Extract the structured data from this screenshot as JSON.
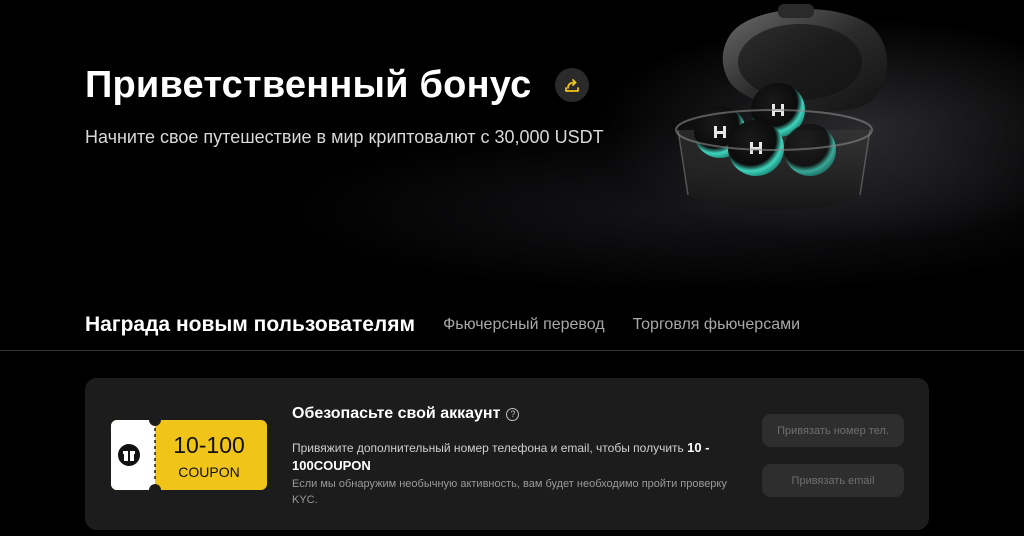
{
  "hero": {
    "title": "Приветственный бонус",
    "subtitle": "Начните свое путешествие в мир криптовалют с 30,000 USDT",
    "share_icon": "share-icon",
    "illustration": "crypto-coins-case-illustration"
  },
  "tabs": [
    {
      "label": "Награда новым пользователям",
      "active": true
    },
    {
      "label": "Фьючерсный перевод",
      "active": false
    },
    {
      "label": "Торговля фьючерсами",
      "active": false
    }
  ],
  "card": {
    "title": "Обезопасьте свой аккаунт",
    "help_icon": "help-icon",
    "coupon": {
      "amount": "10-100",
      "label": "COUPON",
      "icon": "gift-icon"
    },
    "desc_prefix": "Привяжите дополнительный номер телефона и email, чтобы получить ",
    "desc_highlight": "10 - 100COUPON",
    "note": "Если мы обнаружим необычную активность, вам будет необходимо пройти проверку KYC.",
    "bind_phone_label": "Привязать номер тел.",
    "bind_email_label": "Привязать email"
  },
  "colors": {
    "accent": "#f0c419",
    "background": "#000000",
    "card": "#1c1c1c"
  }
}
